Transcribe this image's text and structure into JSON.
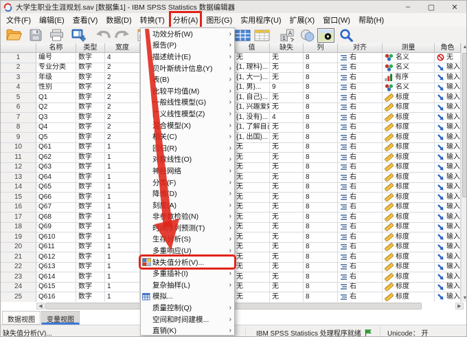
{
  "window": {
    "title": "大学生职业生涯规划.sav [数据集1] - IBM SPSS Statistics 数据编辑器",
    "controls": [
      {
        "name": "minimize-button",
        "glyph": "–"
      },
      {
        "name": "maximize-button",
        "glyph": "▢"
      },
      {
        "name": "close-button",
        "glyph": "✕"
      }
    ]
  },
  "menubar": {
    "items": [
      {
        "label": "文件(F)"
      },
      {
        "label": "编辑(E)"
      },
      {
        "label": "查看(V)"
      },
      {
        "label": "数据(D)"
      },
      {
        "label": "转换(T)"
      },
      {
        "label": "分析(A)",
        "annotated": true
      },
      {
        "label": "图形(G)"
      },
      {
        "label": "实用程序(U)"
      },
      {
        "label": "扩展(X)"
      },
      {
        "label": "窗口(W)"
      },
      {
        "label": "帮助(H)"
      }
    ]
  },
  "toolbar": {
    "left_icons": [
      "open-file-icon",
      "save-icon",
      "print-icon",
      "recall-dialogs-icon",
      "undo-icon",
      "redo-icon",
      "chart-builder-icon"
    ],
    "right_icons": [
      "variables-grid-icon",
      "data-grid-icon",
      "value-labels-icon",
      "use-variable-sets-icon",
      "show-all-variables-icon",
      "find-icon"
    ]
  },
  "analyze_menu": {
    "items": [
      {
        "label": "功效分析(W)",
        "submenu": true
      },
      {
        "label": "报告(P)",
        "submenu": true
      },
      {
        "label": "描述统计(E)",
        "submenu": true
      },
      {
        "label": "贝叶斯统计信息(Y)",
        "submenu": true
      },
      {
        "label": "表(B)",
        "submenu": true
      },
      {
        "label": "比较平均值(M)",
        "submenu": true
      },
      {
        "label": "一般线性模型(G)",
        "submenu": true
      },
      {
        "label": "广义线性模型(Z)",
        "submenu": true
      },
      {
        "label": "混合模型(X)",
        "submenu": true
      },
      {
        "label": "相关(C)",
        "submenu": true
      },
      {
        "label": "回归(R)",
        "submenu": true
      },
      {
        "label": "对数线性(O)",
        "submenu": true
      },
      {
        "label": "神经网络",
        "submenu": true
      },
      {
        "label": "分类(F)",
        "submenu": true
      },
      {
        "label": "降维(D)",
        "submenu": true
      },
      {
        "label": "刻度(A)",
        "submenu": true
      },
      {
        "label": "非参数检验(N)",
        "submenu": true
      },
      {
        "label": "时间序列预测(T)",
        "submenu": true
      },
      {
        "label": "生存分析(S)",
        "submenu": true
      },
      {
        "label": "多重响应(U)",
        "submenu": true
      },
      {
        "label": "缺失值分析(V)...",
        "submenu": false,
        "icon": "missing-values-icon",
        "highlighted": true
      },
      {
        "label": "多重插补(I)",
        "submenu": true
      },
      {
        "label": "复杂抽样(L)",
        "submenu": true
      },
      {
        "label": "模拟...",
        "submenu": false,
        "icon": "simulation-icon"
      },
      {
        "label": "质量控制(Q)",
        "submenu": true
      },
      {
        "label": "空间和时间建模...",
        "submenu": true
      },
      {
        "label": "直销(K)",
        "submenu": true
      }
    ]
  },
  "table": {
    "columns": [
      {
        "key": "num",
        "label": "",
        "width": 52
      },
      {
        "key": "name",
        "label": "名称",
        "width": 58
      },
      {
        "key": "type",
        "label": "类型",
        "width": 42
      },
      {
        "key": "width",
        "label": "宽度",
        "width": 51
      },
      {
        "key": "covered",
        "label": "",
        "width": 137
      },
      {
        "key": "values",
        "label": "值",
        "width": 52
      },
      {
        "key": "missing",
        "label": "缺失",
        "width": 49
      },
      {
        "key": "columns",
        "label": "列",
        "width": 50
      },
      {
        "key": "align",
        "label": "对齐",
        "width": 65
      },
      {
        "key": "measure",
        "label": "测量",
        "width": 76
      },
      {
        "key": "role",
        "label": "角色",
        "width": 38
      }
    ],
    "rows": [
      [
        "1",
        "编号",
        "数字",
        "4",
        "无",
        "无",
        "8",
        "右",
        "nominal",
        "名义",
        "none",
        "无"
      ],
      [
        "2",
        "专业分类",
        "数字",
        "2",
        "{1, 理科}...",
        "无",
        "8",
        "右",
        "nominal",
        "名义",
        "input",
        "输入"
      ],
      [
        "3",
        "年级",
        "数字",
        "2",
        "{1, 大一}...",
        "无",
        "8",
        "右",
        "ordinal",
        "有序",
        "input",
        "输入"
      ],
      [
        "4",
        "性别",
        "数字",
        "2",
        "{1, 男}...",
        "9",
        "8",
        "右",
        "nominal",
        "名义",
        "input",
        "输入"
      ],
      [
        "5",
        "Q1",
        "数字",
        "2",
        "{1, 自己}...",
        "无",
        "8",
        "右",
        "scale",
        "标度",
        "input",
        "输入"
      ],
      [
        "6",
        "Q2",
        "数字",
        "2",
        "{1, 兴趣爱好...",
        "无",
        "8",
        "右",
        "scale",
        "标度",
        "input",
        "输入"
      ],
      [
        "7",
        "Q3",
        "数字",
        "2",
        "{1, 没有}...",
        "4",
        "8",
        "右",
        "scale",
        "标度",
        "input",
        "输入"
      ],
      [
        "8",
        "Q4",
        "数字",
        "2",
        "{1, 了解自己...",
        "无",
        "8",
        "右",
        "scale",
        "标度",
        "input",
        "输入"
      ],
      [
        "9",
        "Q5",
        "数字",
        "2",
        "{1, 出国}...",
        "无",
        "8",
        "右",
        "scale",
        "标度",
        "input",
        "输入"
      ],
      [
        "10",
        "Q61",
        "数字",
        "1",
        "无",
        "无",
        "8",
        "右",
        "scale",
        "标度",
        "input",
        "输入"
      ],
      [
        "11",
        "Q62",
        "数字",
        "1",
        "无",
        "无",
        "8",
        "右",
        "scale",
        "标度",
        "input",
        "输入"
      ],
      [
        "12",
        "Q63",
        "数字",
        "1",
        "无",
        "无",
        "8",
        "右",
        "scale",
        "标度",
        "input",
        "输入"
      ],
      [
        "13",
        "Q64",
        "数字",
        "1",
        "无",
        "无",
        "8",
        "右",
        "scale",
        "标度",
        "input",
        "输入"
      ],
      [
        "14",
        "Q65",
        "数字",
        "1",
        "无",
        "无",
        "8",
        "右",
        "scale",
        "标度",
        "input",
        "输入"
      ],
      [
        "15",
        "Q66",
        "数字",
        "1",
        "无",
        "无",
        "8",
        "右",
        "scale",
        "标度",
        "input",
        "输入"
      ],
      [
        "16",
        "Q67",
        "数字",
        "1",
        "无",
        "无",
        "8",
        "右",
        "scale",
        "标度",
        "input",
        "输入"
      ],
      [
        "17",
        "Q68",
        "数字",
        "1",
        "无",
        "无",
        "8",
        "右",
        "scale",
        "标度",
        "input",
        "输入"
      ],
      [
        "18",
        "Q69",
        "数字",
        "1",
        "无",
        "无",
        "8",
        "右",
        "scale",
        "标度",
        "input",
        "输入"
      ],
      [
        "19",
        "Q610",
        "数字",
        "1",
        "无",
        "无",
        "8",
        "右",
        "scale",
        "标度",
        "input",
        "输入"
      ],
      [
        "20",
        "Q611",
        "数字",
        "1",
        "无",
        "无",
        "8",
        "右",
        "scale",
        "标度",
        "input",
        "输入"
      ],
      [
        "21",
        "Q612",
        "数字",
        "1",
        "无",
        "无",
        "8",
        "右",
        "scale",
        "标度",
        "input",
        "输入"
      ],
      [
        "22",
        "Q613",
        "数字",
        "1",
        "无",
        "无",
        "8",
        "右",
        "scale",
        "标度",
        "input",
        "输入"
      ],
      [
        "23",
        "Q614",
        "数字",
        "1",
        "无",
        "无",
        "8",
        "右",
        "scale",
        "标度",
        "input",
        "输入"
      ],
      [
        "24",
        "Q615",
        "数字",
        "1",
        "无",
        "无",
        "8",
        "右",
        "scale",
        "标度",
        "input",
        "输入"
      ],
      [
        "25",
        "Q616",
        "数字",
        "1",
        "无",
        "无",
        "8",
        "右",
        "scale",
        "标度",
        "input",
        "输入"
      ]
    ]
  },
  "tabs": [
    {
      "label": "数据视图",
      "active": false
    },
    {
      "label": "变量视图",
      "active": true
    }
  ],
  "statusbar": {
    "left_hint": "缺失值分析(V)...",
    "ready": "IBM SPSS Statistics 处理程序就绪",
    "unicode": "Unicode： 开"
  },
  "annotations": {
    "color": "#e02418"
  }
}
